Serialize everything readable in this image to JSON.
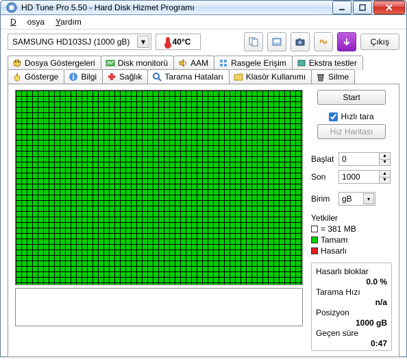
{
  "window": {
    "title": "HD Tune Pro 5.50 - Hard Disk Hizmet Programı"
  },
  "menu": {
    "file": "Dosya",
    "help": "Yardım"
  },
  "drive": {
    "selected": "SAMSUNG HD103SJ (1000 gB)"
  },
  "temp": {
    "value": "40°C"
  },
  "toolbar": {
    "exit": "Çıkış"
  },
  "tabs": {
    "row1": [
      "Dosya Göstergeleri",
      "Disk monitorü",
      "AAM",
      "Rasgele Erişim",
      "Ekstra testler"
    ],
    "row2": [
      "Gösterge",
      "Bilgi",
      "Sağlık",
      "Tarama Hataları",
      "Klasör Kullanımı",
      "Silme"
    ]
  },
  "scan": {
    "start": "Start",
    "quick": "Hızlı tara",
    "speedmap": "Hız Haritası",
    "start_label": "Başlat",
    "start_val": "0",
    "end_label": "Son",
    "end_val": "1000",
    "unit_label": "Birim",
    "unit_val": "gB",
    "legend_title": "Yetkiler",
    "legend_block": "= 381 MB",
    "legend_ok": "Tamam",
    "legend_bad": "Hasarlı"
  },
  "stats": {
    "damaged_lbl": "Hasarlı bloklar",
    "damaged_val": "0.0 %",
    "speed_lbl": "Tarama Hızı",
    "speed_val": "n/a",
    "pos_lbl": "Posizyon",
    "pos_val": "1000 gB",
    "elapsed_lbl": "Geçen süre",
    "elapsed_val": "0:47"
  },
  "colors": {
    "ok": "#00d000",
    "bad": "#e02020",
    "grid": "#000",
    "accent": "#2a7ad2"
  }
}
